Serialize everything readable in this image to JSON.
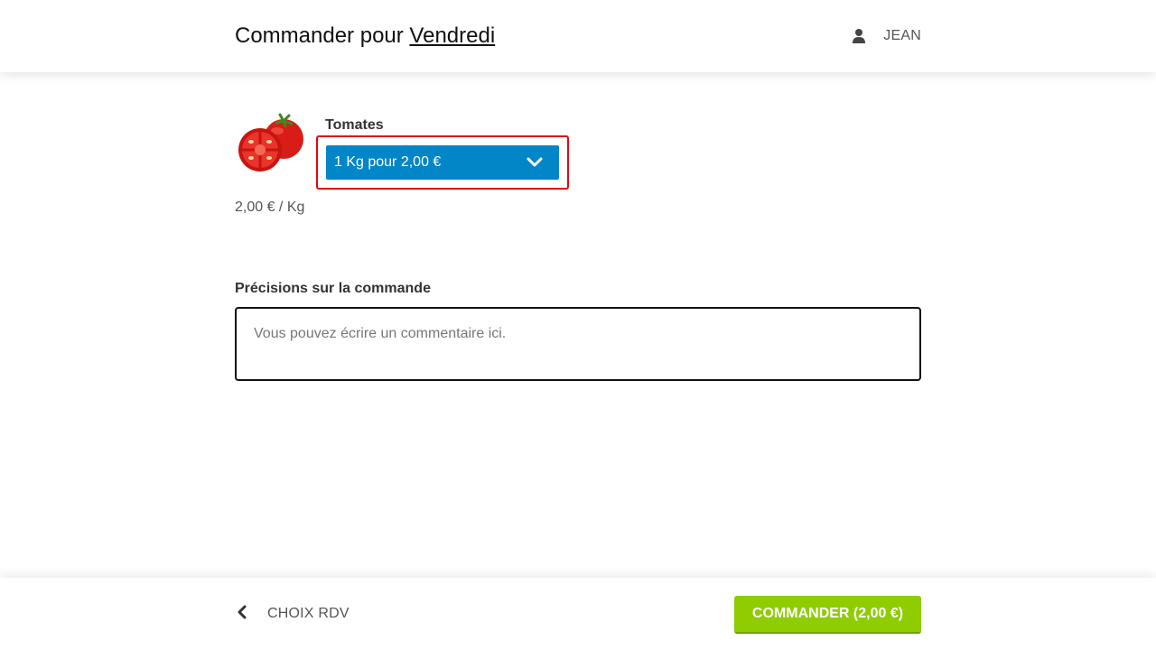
{
  "header": {
    "title_prefix": "Commander pour",
    "title_day": "Vendredi",
    "user_icon": "user-icon",
    "user_name": "JEAN"
  },
  "product": {
    "image": "tomato-image",
    "name": "Tomates",
    "selected_option": "1 Kg pour 2,00 €",
    "dropdown_icon": "chevron-down-icon",
    "unit_price": "2,00 € / Kg"
  },
  "notes": {
    "label": "Précisions sur la commande",
    "placeholder": "Vous pouvez écrire un commentaire ici.",
    "value": ""
  },
  "footer": {
    "back_icon": "chevron-left-icon",
    "back_label": "CHOIX RDV",
    "order_label": "COMMANDER (2,00 €)"
  },
  "colors": {
    "select_background": "#0286c8",
    "highlight_border": "#e30613",
    "order_button": "#8fcc00"
  }
}
